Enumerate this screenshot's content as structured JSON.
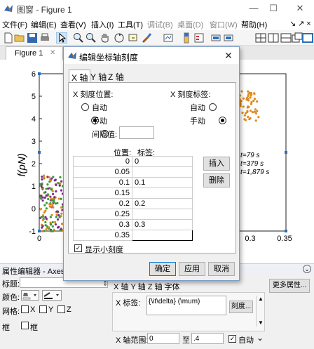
{
  "window": {
    "title": "图窗 - Figure 1",
    "minimize": "—",
    "maximize": "☐",
    "close": "✕"
  },
  "menubar": {
    "items": [
      {
        "label": "文件(F)",
        "enabled": true
      },
      {
        "label": "编辑(E)",
        "enabled": true
      },
      {
        "label": "查看(V)",
        "enabled": true
      },
      {
        "label": "插入(I)",
        "enabled": true
      },
      {
        "label": "工具(T)",
        "enabled": true
      },
      {
        "label": "调试(B)",
        "enabled": false
      },
      {
        "label": "桌面(D)",
        "enabled": false
      },
      {
        "label": "窗口(W)",
        "enabled": false
      },
      {
        "label": "帮助(H)",
        "enabled": true
      }
    ],
    "dock_arrow": "↘",
    "undock_arrow": "↗ ×"
  },
  "figure_tab": {
    "label": "Figure 1",
    "close": "✕"
  },
  "plot": {
    "ylabel": "f(pN)",
    "yticks": [
      "6",
      "5",
      "4",
      "3",
      "2",
      "1",
      "0",
      "-1"
    ],
    "xticks_visible": [
      "0",
      "0.35",
      "0.3"
    ],
    "annotations": [
      "t=79 s",
      "t=379 s",
      "t=1,879 s"
    ]
  },
  "dialog": {
    "title": "编辑坐标轴刻度",
    "close": "✕",
    "tabs": [
      "X 轴",
      "Y 轴",
      "Z 轴"
    ],
    "active_tab": "X 轴",
    "tick_position_heading": "X 刻度位置:",
    "tick_label_heading": "X 刻度标签:",
    "position_options": [
      {
        "label": "自动",
        "selected": false
      },
      {
        "label": "手动",
        "selected": true
      },
      {
        "label": "间隔值:",
        "selected": false
      }
    ],
    "label_options": [
      {
        "label": "自动",
        "selected": false
      },
      {
        "label": "手动",
        "selected": true
      }
    ],
    "interval_value": "",
    "col_position": "位置:",
    "col_label": "标签:",
    "rows": [
      {
        "position": "0",
        "label": "0"
      },
      {
        "position": "0.05",
        "label": ""
      },
      {
        "position": "0.1",
        "label": "0.1"
      },
      {
        "position": "0.15",
        "label": ""
      },
      {
        "position": "0.2",
        "label": "0.2"
      },
      {
        "position": "0.25",
        "label": ""
      },
      {
        "position": "0.3",
        "label": "0.3"
      },
      {
        "position": "0.35",
        "label": ""
      }
    ],
    "insert_button": "插入",
    "delete_button": "删除",
    "show_minor_ticks": "显示小刻度",
    "show_minor_checked": true,
    "ok_button": "确定",
    "apply_button": "应用",
    "cancel_button": "取消"
  },
  "property_editor": {
    "title": "属性编辑器 - Axes",
    "title_label": "标题:",
    "title_value": "",
    "color_label": "颜色:",
    "grid_label": "网格:",
    "grid_x": "X",
    "grid_y": "Y",
    "grid_z": "Z",
    "box_label": "框",
    "box_check": "框",
    "axis_tabs": "X 轴  Y 轴  Z 轴  字体",
    "more_props": "更多属性...",
    "x_label_caption": "X 标签:",
    "x_label_value": "{\\it\\delta} (\\mum)",
    "ticks_button": "刻度...",
    "x_range_caption": "X 轴范围:",
    "x_range_min": "0",
    "x_range_to": "至",
    "x_range_max": ".4",
    "auto_label": "自动",
    "expand": "⌄"
  }
}
